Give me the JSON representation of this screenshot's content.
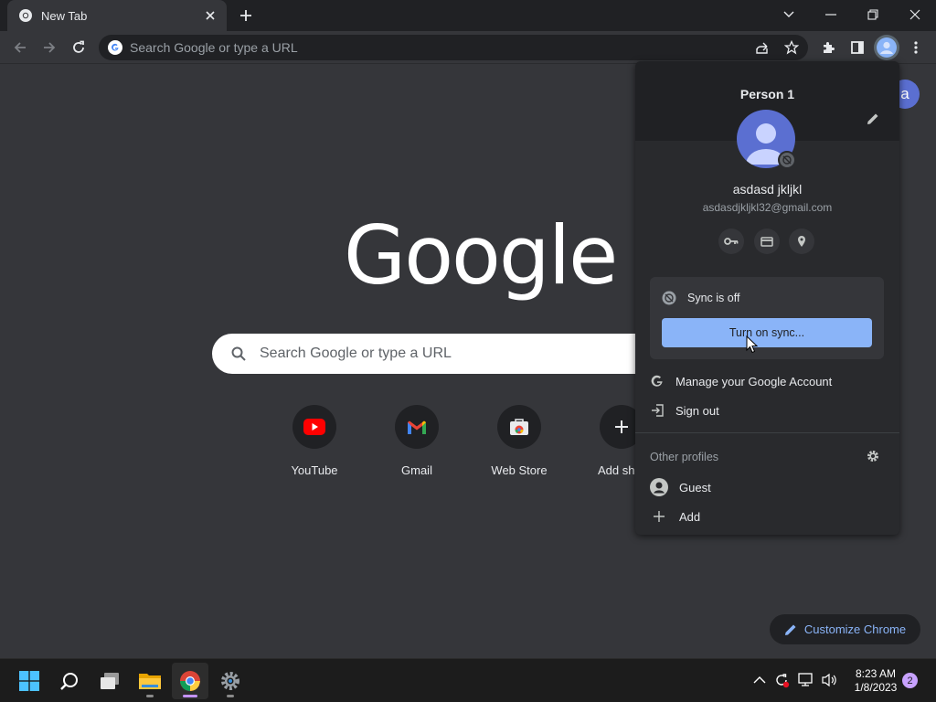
{
  "tab": {
    "title": "New Tab"
  },
  "omnibox": {
    "placeholder": "Search Google or type a URL"
  },
  "ntp": {
    "logo": "Google",
    "search_placeholder": "Search Google or type a URL",
    "shortcuts": [
      {
        "label": "YouTube",
        "icon": "youtube-icon"
      },
      {
        "label": "Gmail",
        "icon": "gmail-icon"
      },
      {
        "label": "Web Store",
        "icon": "web-store-icon"
      },
      {
        "label": "Add shor",
        "icon": "plus-icon"
      }
    ],
    "customize_label": "Customize Chrome",
    "avatar_letter": "a"
  },
  "profile_menu": {
    "profile_name": "Person 1",
    "full_name": "asdasd jkljkl",
    "email": "asdasdjkljkl32@gmail.com",
    "sync_status": "Sync is off",
    "sync_button": "Turn on sync...",
    "manage_account": "Manage your Google Account",
    "sign_out": "Sign out",
    "other_profiles_label": "Other profiles",
    "guest": "Guest",
    "add": "Add"
  },
  "taskbar": {
    "time": "8:23 AM",
    "date": "1/8/2023",
    "notification_count": "2"
  },
  "colors": {
    "accent": "#8ab4f8",
    "page_bg": "#35363a",
    "frame_bg": "#202124",
    "avatar": "#5b6fd1"
  }
}
